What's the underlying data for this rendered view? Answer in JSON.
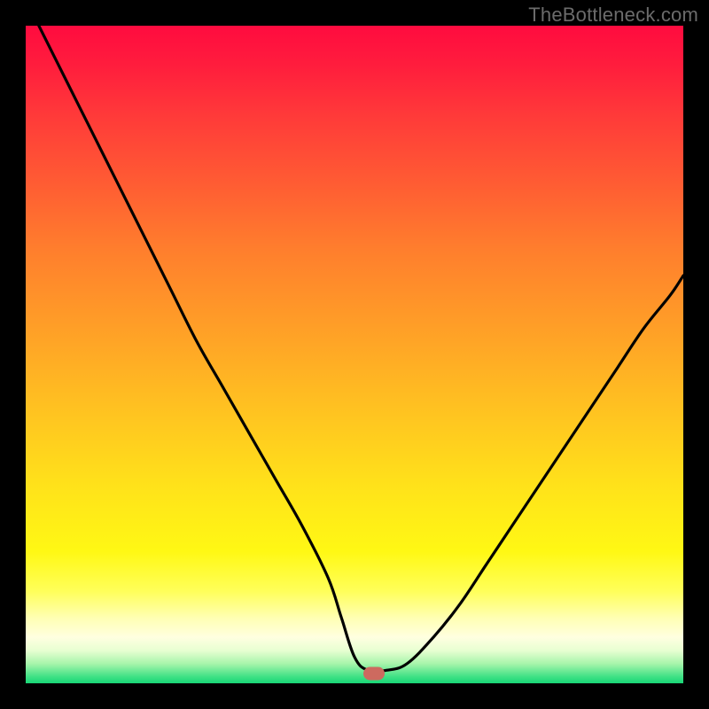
{
  "watermark": "TheBottleneck.com",
  "chart_data": {
    "type": "line",
    "title": "",
    "xlabel": "",
    "ylabel": "",
    "xlim": [
      0,
      100
    ],
    "ylim": [
      0,
      100
    ],
    "grid": false,
    "legend": false,
    "background": {
      "type": "vertical-gradient",
      "stops": [
        {
          "pct": 0,
          "color": "#ff0b3f"
        },
        {
          "pct": 24,
          "color": "#ff5c33"
        },
        {
          "pct": 46,
          "color": "#ff9f27"
        },
        {
          "pct": 70,
          "color": "#ffe21a"
        },
        {
          "pct": 90,
          "color": "#ffffb2"
        },
        {
          "pct": 100,
          "color": "#18d676"
        }
      ]
    },
    "series": [
      {
        "name": "bottleneck-curve",
        "color": "#000000",
        "x": [
          2,
          6,
          10,
          14,
          18,
          22,
          26,
          30,
          34,
          38,
          42,
          46,
          48,
          50,
          52,
          55,
          58,
          62,
          66,
          70,
          74,
          78,
          82,
          86,
          90,
          94,
          98,
          100
        ],
        "y": [
          100,
          92,
          84,
          76,
          68,
          60,
          52,
          45,
          38,
          31,
          24,
          16,
          10,
          4,
          2,
          2,
          3,
          7,
          12,
          18,
          24,
          30,
          36,
          42,
          48,
          54,
          59,
          62
        ]
      }
    ],
    "marker": {
      "name": "optimal-point",
      "x": 53,
      "y": 1.5,
      "color": "#cd6a5f"
    }
  }
}
